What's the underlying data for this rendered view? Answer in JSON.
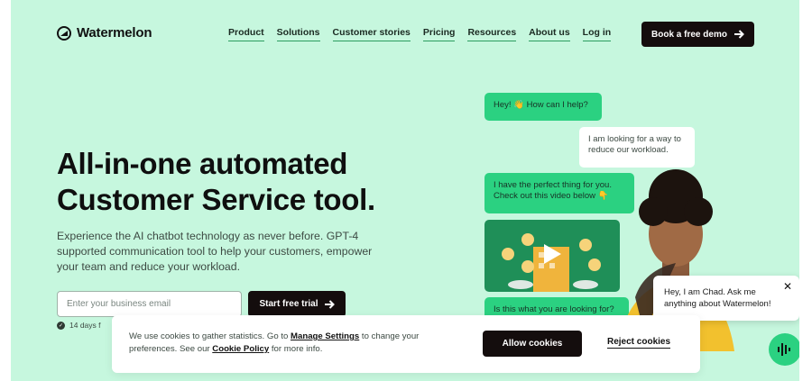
{
  "brand": {
    "name": "Watermelon",
    "accent": "#2bd181",
    "background": "#c6f7de",
    "dark": "#140d0d"
  },
  "nav": {
    "items": [
      {
        "label": "Product"
      },
      {
        "label": "Solutions"
      },
      {
        "label": "Customer stories"
      },
      {
        "label": "Pricing"
      },
      {
        "label": "Resources"
      },
      {
        "label": "About us"
      },
      {
        "label": "Log in"
      }
    ],
    "demo_button": "Book a free demo",
    "demo_icon": "arrow-right-icon"
  },
  "hero": {
    "title_line1": "All-in-one automated",
    "title_line2": "Customer Service tool.",
    "subtitle": "Experience the AI chatbot technology as never before. GPT-4 supported communication tool to help your customers, empower your team and reduce your workload.",
    "email_placeholder": "Enter your business email",
    "email_value": "",
    "trial_button": "Start free trial",
    "trial_note": "14 days f"
  },
  "chat_demo": {
    "bubble1": "Hey! 👋 How can I help?",
    "bubble2": "I am looking for a way to reduce our workload.",
    "bubble3": "I have the perfect thing for you. Check out this video below 👇",
    "bubble4": "Is this what you are looking for?",
    "video_icon": "play-icon"
  },
  "chat_widget": {
    "message": "Hey, I am Chad. Ask me anything about Watermelon!",
    "close_label": "✕",
    "launcher_icon": "sound-wave-icon"
  },
  "cookie_banner": {
    "text_before": "We use cookies to gather statistics. Go to",
    "manage_link": "Manage Settings",
    "text_middle": "to change your preferences. See our",
    "policy_link": "Cookie Policy",
    "text_after": "for more info.",
    "allow_button": "Allow cookies",
    "reject_button": "Reject cookies"
  }
}
